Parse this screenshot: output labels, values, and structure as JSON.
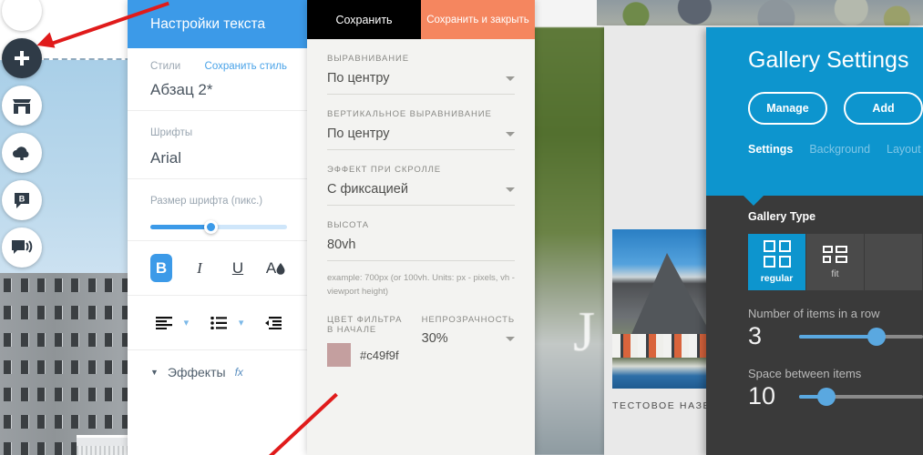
{
  "rail": {
    "items": [
      {
        "name": "add-element",
        "icon": "plus-icon"
      },
      {
        "name": "store",
        "icon": "store-icon"
      },
      {
        "name": "upload",
        "icon": "cloud-upload-icon"
      },
      {
        "name": "blog",
        "icon": "blog-bubble-icon"
      },
      {
        "name": "chat",
        "icon": "chat-bubble-icon"
      }
    ]
  },
  "text_panel": {
    "title": "Настройки текста",
    "styles_label": "Стили",
    "styles_link": "Сохранить стиль",
    "styles_value": "Абзац 2*",
    "fonts_label": "Шрифты",
    "fonts_value": "Arial",
    "size_label": "Размер шрифта (пикс.)",
    "format_buttons": [
      "B",
      "I",
      "U",
      "A"
    ],
    "effects_label": "Эффекты",
    "effects_fx": "fx"
  },
  "mid_panel": {
    "tab_save": "Сохранить",
    "tab_save_close": "Сохранить и закрыть",
    "fields": [
      {
        "label": "ВЫРАВНИВАНИЕ",
        "value": "По центру"
      },
      {
        "label": "ВЕРТИКАЛЬНОЕ ВЫРАВНИВАНИЕ",
        "value": "По центру"
      },
      {
        "label": "ЭФФЕКТ ПРИ СКРОЛЛЕ",
        "value": "С фиксацией"
      },
      {
        "label": "ВЫСОТА",
        "value": "80vh"
      }
    ],
    "hint": "example: 700px (or 100vh. Units: px - pixels, vh - viewport height)",
    "filter_label": "ЦВЕТ ФИЛЬТРА В НАЧАЛЕ",
    "filter_color": "#c49f9f",
    "opacity_label": "НЕПРОЗРАЧНОСТЬ",
    "opacity_value": "30%"
  },
  "gallery_panel": {
    "title": "Gallery Settings",
    "manage_button": "Manage",
    "add_button": "Add",
    "tabs": [
      {
        "label": "Settings",
        "active": true
      },
      {
        "label": "Background",
        "active": false
      },
      {
        "label": "Layout",
        "active": false
      }
    ],
    "gallery_type_label": "Gallery Type",
    "types": [
      {
        "label": "regular",
        "active": true
      },
      {
        "label": "fit",
        "active": false
      }
    ],
    "items_in_row_label": "Number of items in a row",
    "items_in_row_value": "3",
    "space_label": "Space between items",
    "space_value": "10",
    "accent_color": "#0d95ce"
  },
  "preview": {
    "gallery_caption": "ТЕСТОВОЕ НАЗВАНИЕ",
    "letter": "J"
  }
}
